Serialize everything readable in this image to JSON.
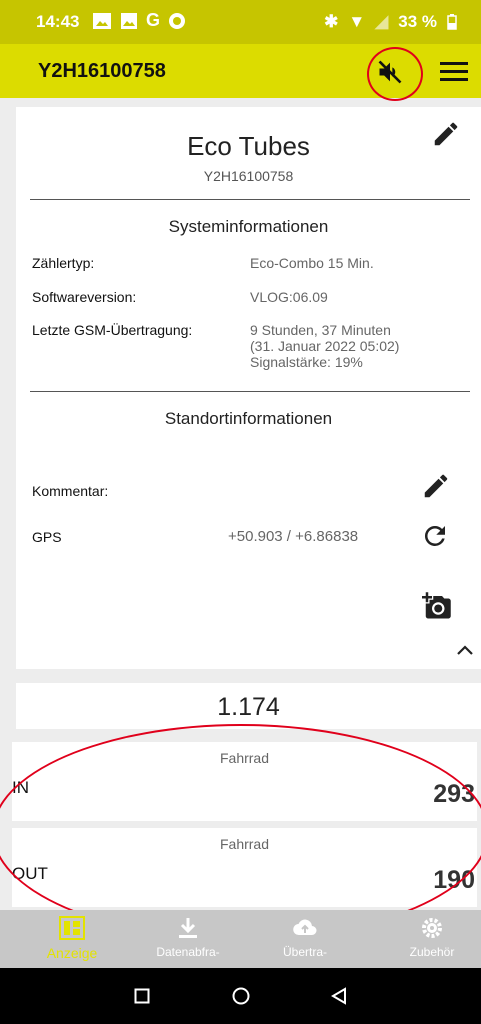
{
  "status_bar": {
    "time": "14:43",
    "battery": "33 %"
  },
  "app_bar": {
    "title": "Y2H16100758"
  },
  "device": {
    "name": "Eco Tubes",
    "serial": "Y2H16100758"
  },
  "system_info": {
    "heading": "Systeminformationen",
    "rows": [
      {
        "label": "Zählertyp:",
        "value": "Eco-Combo 15 Min."
      },
      {
        "label": "Softwareversion:",
        "value": "VLOG:06.09"
      },
      {
        "label": "Letzte GSM-Übertragung:",
        "value_lines": [
          "9 Stunden, 37 Minuten",
          "(31. Januar 2022 05:02)",
          "Signalstärke: 19%"
        ]
      }
    ]
  },
  "location_info": {
    "heading": "Standortinformationen",
    "comment_label": "Kommentar:",
    "gps_label": "GPS",
    "gps_value": "+50.903 / +6.86838"
  },
  "counter": {
    "total": "1.174"
  },
  "channels": [
    {
      "category": "Fahrrad",
      "direction": "IN",
      "count": "293"
    },
    {
      "category": "Fahrrad",
      "direction": "OUT",
      "count": "190"
    }
  ],
  "bottom_nav": [
    {
      "label": "Anzeige",
      "icon": "display-icon"
    },
    {
      "label": "Datenabfra-",
      "icon": "download-icon"
    },
    {
      "label": "Übertra-",
      "icon": "cloud-upload-icon"
    },
    {
      "label": "Zubehör",
      "icon": "gear-icon"
    }
  ],
  "colors": {
    "accent": "#dcdc00",
    "status_bar": "#c6c500",
    "annotation": "#e0001b",
    "nav_active": "#e3e300"
  }
}
